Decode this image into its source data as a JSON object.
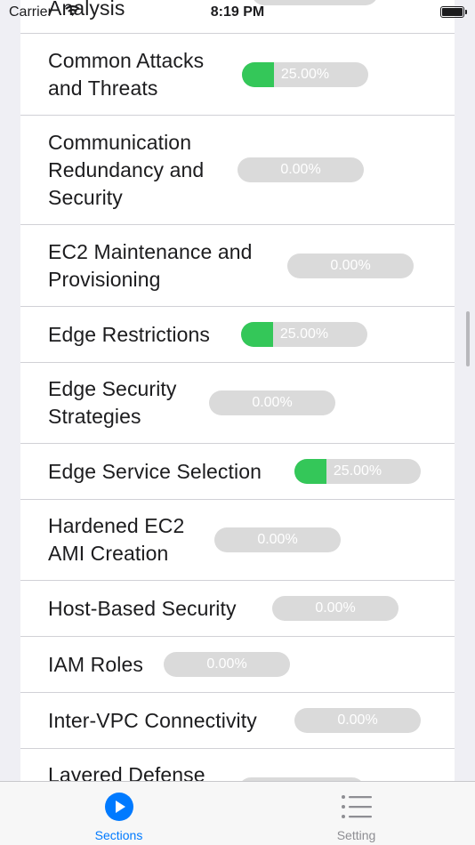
{
  "status_bar": {
    "carrier": "Carrier",
    "time": "8:19 PM"
  },
  "sections": [
    {
      "title": "Analysis",
      "percent_text": "",
      "progress": 0
    },
    {
      "title": "Common Attacks and Threats",
      "percent_text": "25.00%",
      "progress": 0.25
    },
    {
      "title": "Communication Redundancy and Security",
      "percent_text": "0.00%",
      "progress": 0
    },
    {
      "title": "EC2 Maintenance and Provisioning",
      "percent_text": "0.00%",
      "progress": 0
    },
    {
      "title": "Edge Restrictions",
      "percent_text": "25.00%",
      "progress": 0.25
    },
    {
      "title": "Edge Security Strategies",
      "percent_text": "0.00%",
      "progress": 0
    },
    {
      "title": "Edge Service Selection",
      "percent_text": "25.00%",
      "progress": 0.25
    },
    {
      "title": "Hardened EC2 AMI Creation",
      "percent_text": "0.00%",
      "progress": 0
    },
    {
      "title": "Host-Based Security",
      "percent_text": "0.00%",
      "progress": 0
    },
    {
      "title": "IAM Roles",
      "percent_text": "0.00%",
      "progress": 0
    },
    {
      "title": "Inter-VPC Connectivity",
      "percent_text": "0.00%",
      "progress": 0
    },
    {
      "title": "Layered Defense",
      "percent_text": "",
      "progress": 0
    }
  ],
  "tab_bar": {
    "tabs": [
      {
        "label": "Sections",
        "icon": "play-circle-icon",
        "active": true
      },
      {
        "label": "Setting",
        "icon": "list-icon",
        "active": false
      }
    ]
  },
  "colors": {
    "accent": "#007aff",
    "progress_fill": "#34c759",
    "progress_track": "#dadada"
  }
}
